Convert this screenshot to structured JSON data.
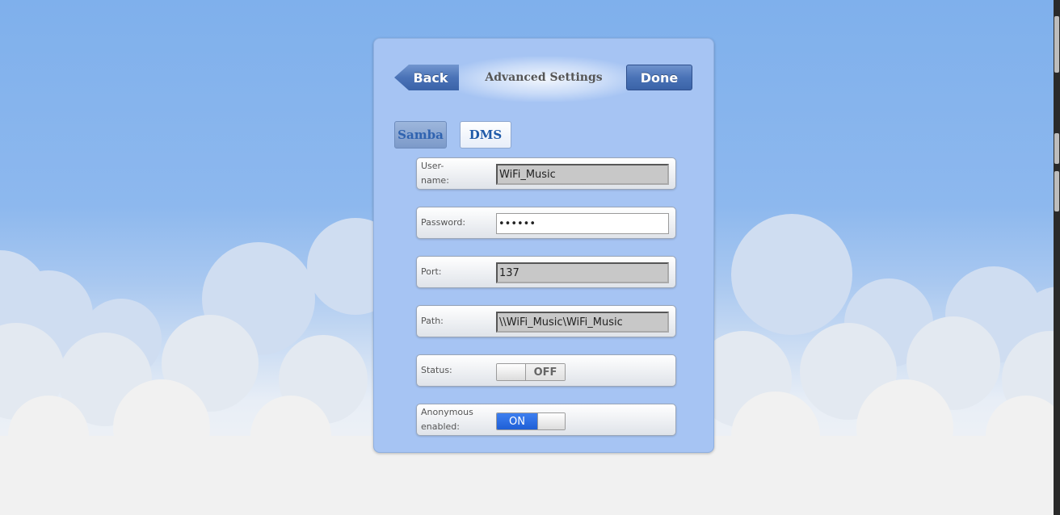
{
  "header": {
    "back_label": "Back",
    "title": "Advanced Settings",
    "done_label": "Done"
  },
  "tabs": [
    {
      "label": "Samba",
      "selected": true
    },
    {
      "label": "DMS",
      "selected": false
    }
  ],
  "fields": {
    "username": {
      "label": "User-name:",
      "value": "WiFi_Music"
    },
    "password": {
      "label": "Password:",
      "value": "••••••"
    },
    "port": {
      "label": "Port:",
      "value": "137"
    },
    "path": {
      "label": "Path:",
      "value": "\\\\WiFi_Music\\WiFi_Music"
    },
    "status": {
      "label": "Status:",
      "toggle_text": "OFF",
      "on": false
    },
    "anonymous": {
      "label": "Anonymous enabled:",
      "toggle_text": "ON",
      "on": true
    }
  },
  "colors": {
    "primary_button": "#4a73b7",
    "toggle_on": "#2f6fe3",
    "panel": "#a6c4f3",
    "sky": "#7fb0ec"
  }
}
